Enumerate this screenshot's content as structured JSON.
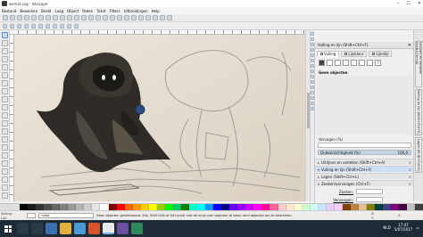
{
  "window": {
    "title": "werkst.svg - Inkscape",
    "controls": [
      "–",
      "☐",
      "✕"
    ]
  },
  "menu": [
    "Bestand",
    "Bewerken",
    "Beeld",
    "Laag",
    "Object",
    "Paden",
    "Tekst",
    "Filters",
    "Uitbreidingen",
    "Help"
  ],
  "dock": {
    "title": "Vulling en lijn (Shift+Ctrl+F)",
    "close": "✕",
    "tabs": [
      "Vulling",
      "Lijnkleur",
      "Lijnstijl"
    ],
    "no_object": "Geen objecten",
    "unknown_paint": "?",
    "blur": {
      "label": "Vervagen (%)",
      "value": ""
    },
    "opacity": {
      "label": "Ondoorzichtigheid (%)",
      "value": "100,0"
    },
    "panels": [
      {
        "label": "Uitlijnen en verdelen (Shift+Ctrl+A)",
        "selected": false
      },
      {
        "label": "Vulling en lijn (Shift+Ctrl+F)",
        "selected": true
      },
      {
        "label": "Lagen (Shift+Ctrl+L)",
        "selected": false
      },
      {
        "label": "Zoeken/vervangen (Ctrl+F)",
        "selected": false
      }
    ],
    "search_label": "Zoeken:",
    "replace_label": "Vervangen:"
  },
  "side_tabs": [
    "Uitlijnen en verdelen (Shift+Ctrl+A)",
    "Vulling en lijn (Shift+Ctrl+F)",
    "Lagen (Shift+Ctrl+L)"
  ],
  "status": {
    "fill_label": "Vulling:",
    "stroke_label": "Lijn:",
    "layer": "•root",
    "message": "Geen objecten geselecteerd. Klik, Shift+klik of Alt+scroll met de muis over objecten of sleep rond objecten om te selecteren.",
    "x_label": "X:",
    "y_label": "Y:",
    "zoom_label": "Z:"
  },
  "tray": {
    "lang": "NLD",
    "time": "17:47",
    "date": "5/07/2017"
  },
  "colors": {
    "palette": [
      "#000000",
      "#1a1a1a",
      "#333333",
      "#4d4d4d",
      "#666666",
      "#808080",
      "#999999",
      "#b3b3b3",
      "#cccccc",
      "#e6e6e6",
      "#ffffff",
      "#800000",
      "#ff0000",
      "#ff6600",
      "#ff9900",
      "#ffcc00",
      "#ffff00",
      "#99cc00",
      "#00ff00",
      "#00cc66",
      "#008000",
      "#00ffcc",
      "#00ffff",
      "#0099ff",
      "#0000ff",
      "#000080",
      "#6600ff",
      "#9900ff",
      "#cc00ff",
      "#ff00ff",
      "#ff0099",
      "#ff6699",
      "#ffcccc",
      "#ffe6cc",
      "#ffffcc",
      "#ccffcc",
      "#ccffff",
      "#cce6ff",
      "#e6ccff",
      "#ffccff",
      "#804000",
      "#c08040",
      "#e0c090",
      "#808000",
      "#004040",
      "#404080",
      "#800080",
      "#400040",
      "#c0c0c0",
      "#404040"
    ]
  }
}
